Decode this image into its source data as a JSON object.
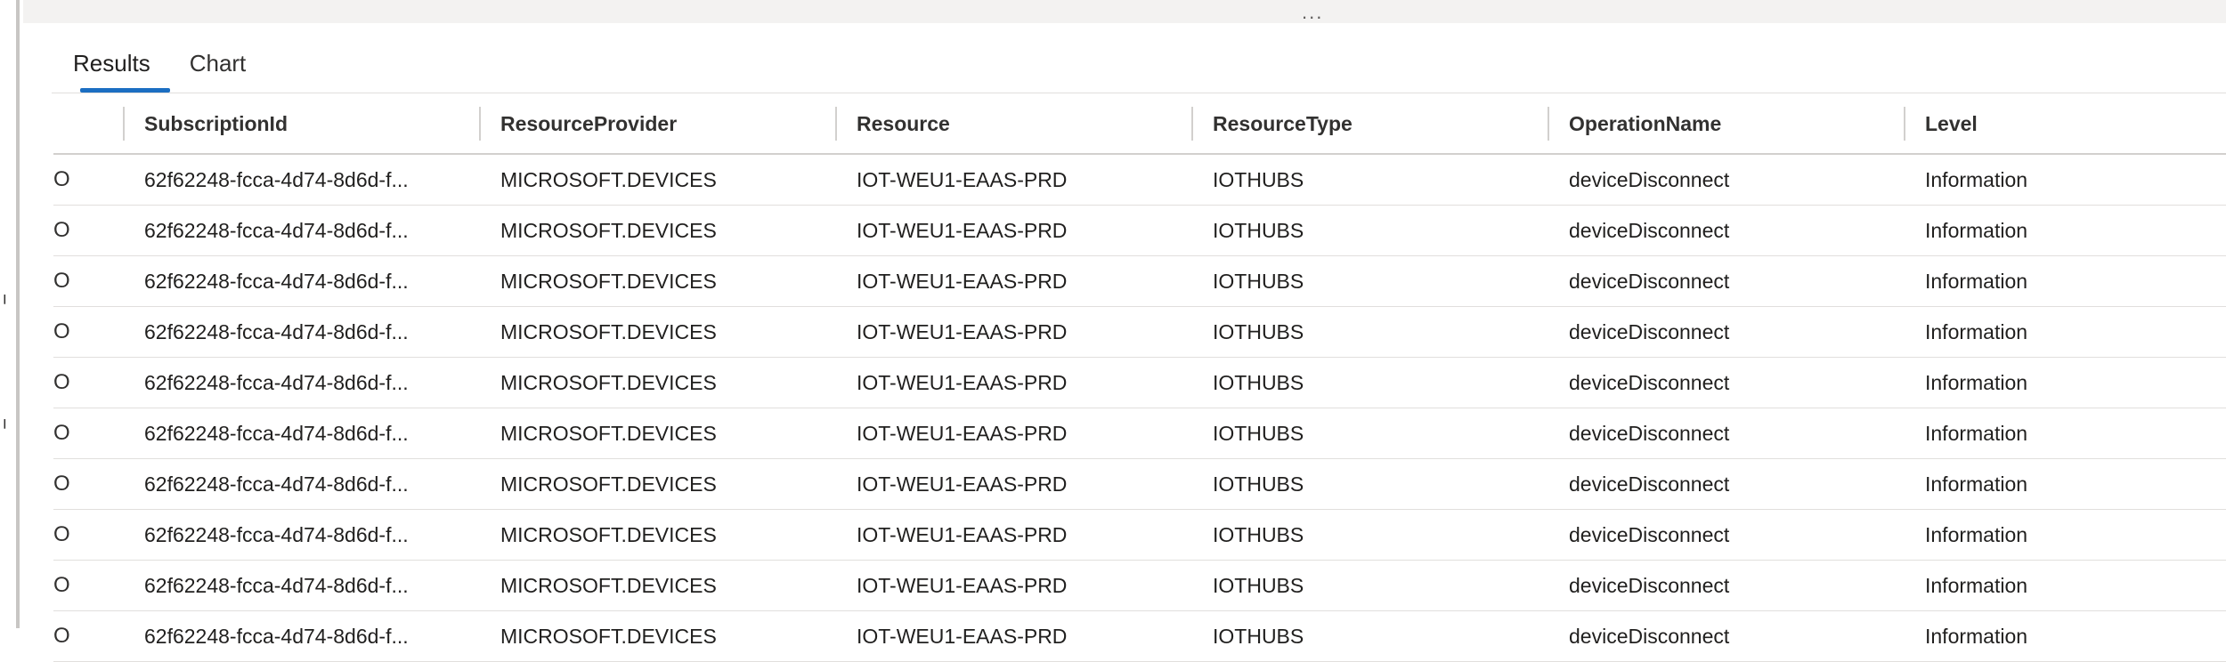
{
  "splitter": {
    "dots": "..."
  },
  "tabs": {
    "results": "Results",
    "chart": "Chart"
  },
  "table": {
    "columns": [
      "SubscriptionId",
      "ResourceProvider",
      "Resource",
      "ResourceType",
      "OperationName",
      "Level"
    ],
    "rows": [
      {
        "sel": "O",
        "SubscriptionId": "62f62248-fcca-4d74-8d6d-f...",
        "ResourceProvider": "MICROSOFT.DEVICES",
        "Resource": "IOT-WEU1-EAAS-PRD",
        "ResourceType": "IOTHUBS",
        "OperationName": "deviceDisconnect",
        "Level": "Information"
      },
      {
        "sel": "O",
        "SubscriptionId": "62f62248-fcca-4d74-8d6d-f...",
        "ResourceProvider": "MICROSOFT.DEVICES",
        "Resource": "IOT-WEU1-EAAS-PRD",
        "ResourceType": "IOTHUBS",
        "OperationName": "deviceDisconnect",
        "Level": "Information"
      },
      {
        "sel": "O",
        "SubscriptionId": "62f62248-fcca-4d74-8d6d-f...",
        "ResourceProvider": "MICROSOFT.DEVICES",
        "Resource": "IOT-WEU1-EAAS-PRD",
        "ResourceType": "IOTHUBS",
        "OperationName": "deviceDisconnect",
        "Level": "Information"
      },
      {
        "sel": "O",
        "SubscriptionId": "62f62248-fcca-4d74-8d6d-f...",
        "ResourceProvider": "MICROSOFT.DEVICES",
        "Resource": "IOT-WEU1-EAAS-PRD",
        "ResourceType": "IOTHUBS",
        "OperationName": "deviceDisconnect",
        "Level": "Information"
      },
      {
        "sel": "O",
        "SubscriptionId": "62f62248-fcca-4d74-8d6d-f...",
        "ResourceProvider": "MICROSOFT.DEVICES",
        "Resource": "IOT-WEU1-EAAS-PRD",
        "ResourceType": "IOTHUBS",
        "OperationName": "deviceDisconnect",
        "Level": "Information"
      },
      {
        "sel": "O",
        "SubscriptionId": "62f62248-fcca-4d74-8d6d-f...",
        "ResourceProvider": "MICROSOFT.DEVICES",
        "Resource": "IOT-WEU1-EAAS-PRD",
        "ResourceType": "IOTHUBS",
        "OperationName": "deviceDisconnect",
        "Level": "Information"
      },
      {
        "sel": "O",
        "SubscriptionId": "62f62248-fcca-4d74-8d6d-f...",
        "ResourceProvider": "MICROSOFT.DEVICES",
        "Resource": "IOT-WEU1-EAAS-PRD",
        "ResourceType": "IOTHUBS",
        "OperationName": "deviceDisconnect",
        "Level": "Information"
      },
      {
        "sel": "O",
        "SubscriptionId": "62f62248-fcca-4d74-8d6d-f...",
        "ResourceProvider": "MICROSOFT.DEVICES",
        "Resource": "IOT-WEU1-EAAS-PRD",
        "ResourceType": "IOTHUBS",
        "OperationName": "deviceDisconnect",
        "Level": "Information"
      },
      {
        "sel": "O",
        "SubscriptionId": "62f62248-fcca-4d74-8d6d-f...",
        "ResourceProvider": "MICROSOFT.DEVICES",
        "Resource": "IOT-WEU1-EAAS-PRD",
        "ResourceType": "IOTHUBS",
        "OperationName": "deviceDisconnect",
        "Level": "Information"
      },
      {
        "sel": "O",
        "SubscriptionId": "62f62248-fcca-4d74-8d6d-f...",
        "ResourceProvider": "MICROSOFT.DEVICES",
        "Resource": "IOT-WEU1-EAAS-PRD",
        "ResourceType": "IOTHUBS",
        "OperationName": "deviceDisconnect",
        "Level": "Information"
      }
    ]
  }
}
